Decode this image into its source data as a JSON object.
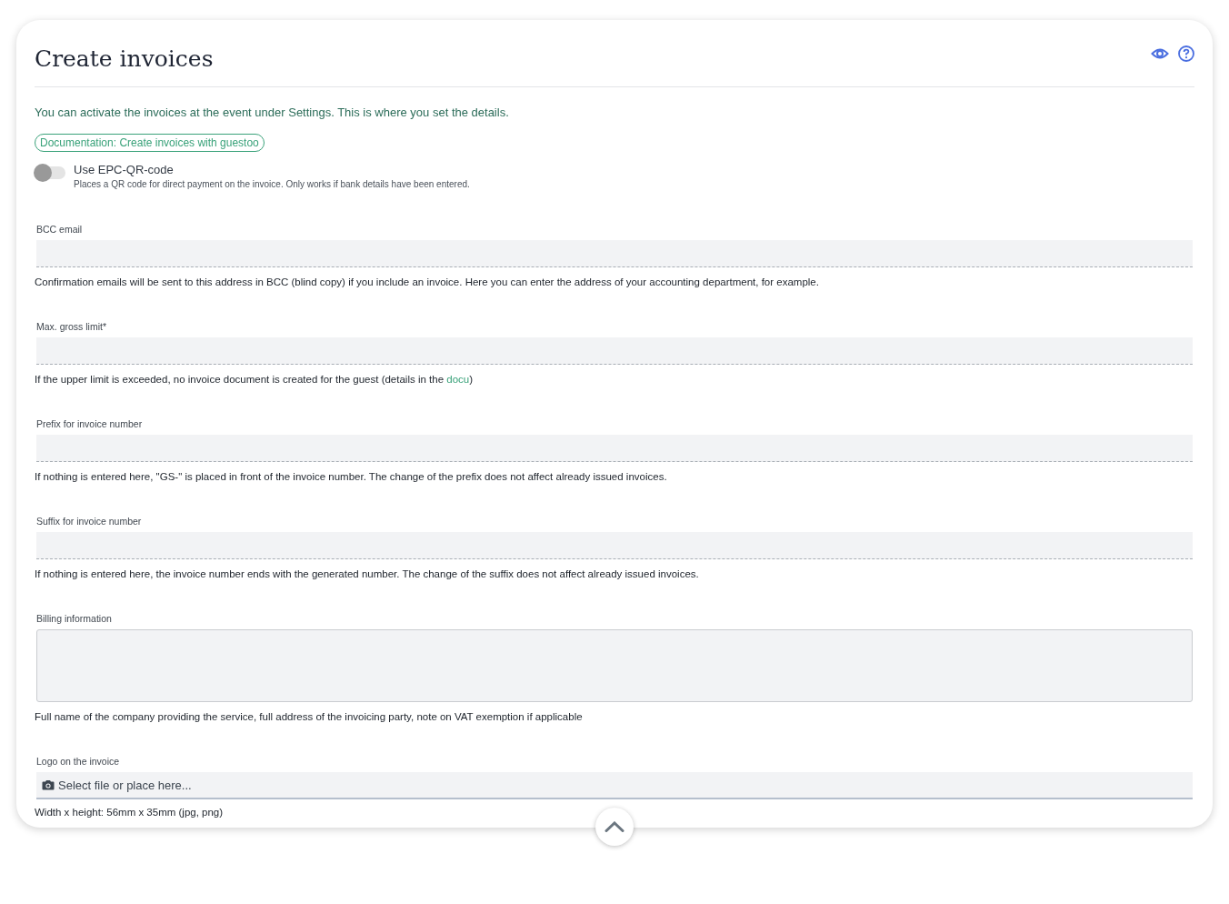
{
  "title": "Create invoices",
  "intro": "You can activate the invoices at the event under Settings. This is where you set the details.",
  "doc_link": "Documentation: Create invoices with guestoo",
  "qr_toggle": {
    "label": "Use EPC-QR-code",
    "description": "Places a QR code for direct payment on the invoice. Only works if bank details have been entered.",
    "on": false
  },
  "fields": [
    {
      "kind": "input",
      "label": "BCC email",
      "hint": [
        {
          "kind": "text",
          "text": "Confirmation emails will be sent to this address in BCC (blind copy) if you include an invoice. Here you can enter the address of your accounting department, for example."
        }
      ]
    },
    {
      "kind": "input",
      "label": "Max. gross limit*",
      "hint": [
        {
          "kind": "text",
          "text": "If the upper limit is exceeded, no invoice document is created for the guest (details in the "
        },
        {
          "kind": "link",
          "text": "docu"
        },
        {
          "kind": "text",
          "text": ")"
        }
      ]
    },
    {
      "kind": "input",
      "label": "Prefix for invoice number",
      "hint": [
        {
          "kind": "text",
          "text": "If nothing is entered here, \"GS-\" is placed in front of the invoice number. The change of the prefix does not affect already issued invoices."
        }
      ]
    },
    {
      "kind": "input",
      "label": "Suffix for invoice number",
      "hint": [
        {
          "kind": "text",
          "text": "If nothing is entered here, the invoice number ends with the generated number. The change of the suffix does not affect already issued invoices."
        }
      ]
    },
    {
      "kind": "textarea",
      "label": "Billing information",
      "hint": [
        {
          "kind": "text",
          "text": "Full name of the company providing the service, full address of the invoicing party, note on VAT exemption if applicable"
        }
      ]
    },
    {
      "kind": "file",
      "label": "Logo on the invoice",
      "placeholder": "Select file or place here...",
      "hint": [
        {
          "kind": "text",
          "text": "Width x height: 56mm x 35mm (jpg, png)"
        }
      ]
    }
  ]
}
